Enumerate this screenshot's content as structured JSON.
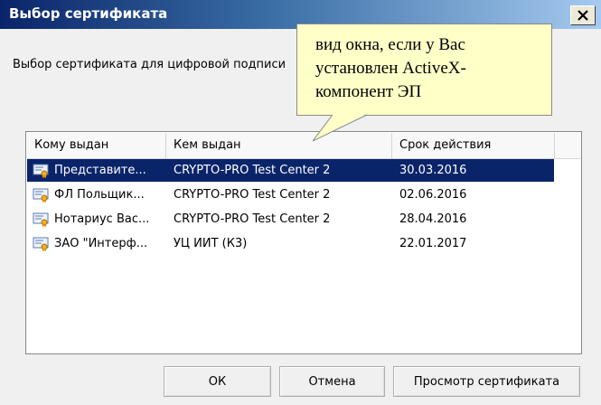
{
  "window": {
    "title": "Выбор сертификата",
    "close_label": "X"
  },
  "dialog": {
    "description": "Выбор сертификата для цифровой подписи"
  },
  "tooltip": {
    "lines": [
      "вид окна, если у Вас",
      "установлен ActiveX-",
      "компонент ЭП"
    ]
  },
  "table": {
    "columns": [
      "Кому выдан",
      "Кем выдан",
      "Срок действия"
    ],
    "rows": [
      {
        "issued_to": "Представите...",
        "issued_by": "CRYPTO-PRO Test Center 2",
        "valid_until": "30.03.2016",
        "selected": true
      },
      {
        "issued_to": "ФЛ Польщик...",
        "issued_by": "CRYPTO-PRO Test Center 2",
        "valid_until": "02.06.2016",
        "selected": false
      },
      {
        "issued_to": "Нотариус Вас...",
        "issued_by": "CRYPTO-PRO Test Center 2",
        "valid_until": "28.04.2016",
        "selected": false
      },
      {
        "issued_to": "ЗАО \"Интерф...",
        "issued_by": "УЦ ИИТ (К3)",
        "valid_until": "22.01.2017",
        "selected": false
      }
    ]
  },
  "buttons": {
    "ok": "ОК",
    "cancel": "Отмена",
    "view": "Просмотр сертификата"
  }
}
